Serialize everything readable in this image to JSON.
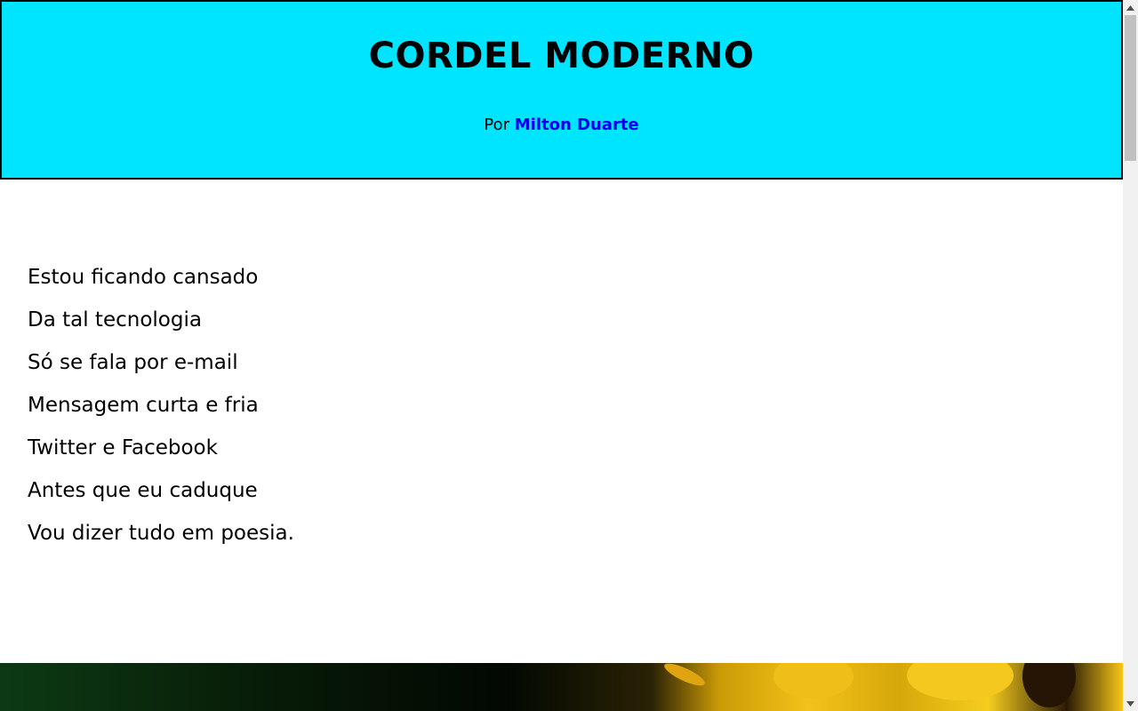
{
  "header": {
    "title": "CORDEL MODERNO",
    "byline_prefix": "Por",
    "author": "Milton Duarte",
    "background_color": "#00e5ff",
    "link_color": "#0000ee"
  },
  "poem": {
    "lines": [
      "Estou ficando cansado",
      "Da tal tecnologia",
      "Só se fala por e-mail",
      "Mensagem curta e fria",
      "Twitter e Facebook",
      "Antes que eu caduque",
      "Vou dizer tudo em poesia."
    ]
  },
  "hero_image": {
    "icon": "yellow-flower-photo"
  },
  "scrollbar": {
    "up_icon": "triangle-up-icon",
    "down_icon": "triangle-down-icon"
  }
}
